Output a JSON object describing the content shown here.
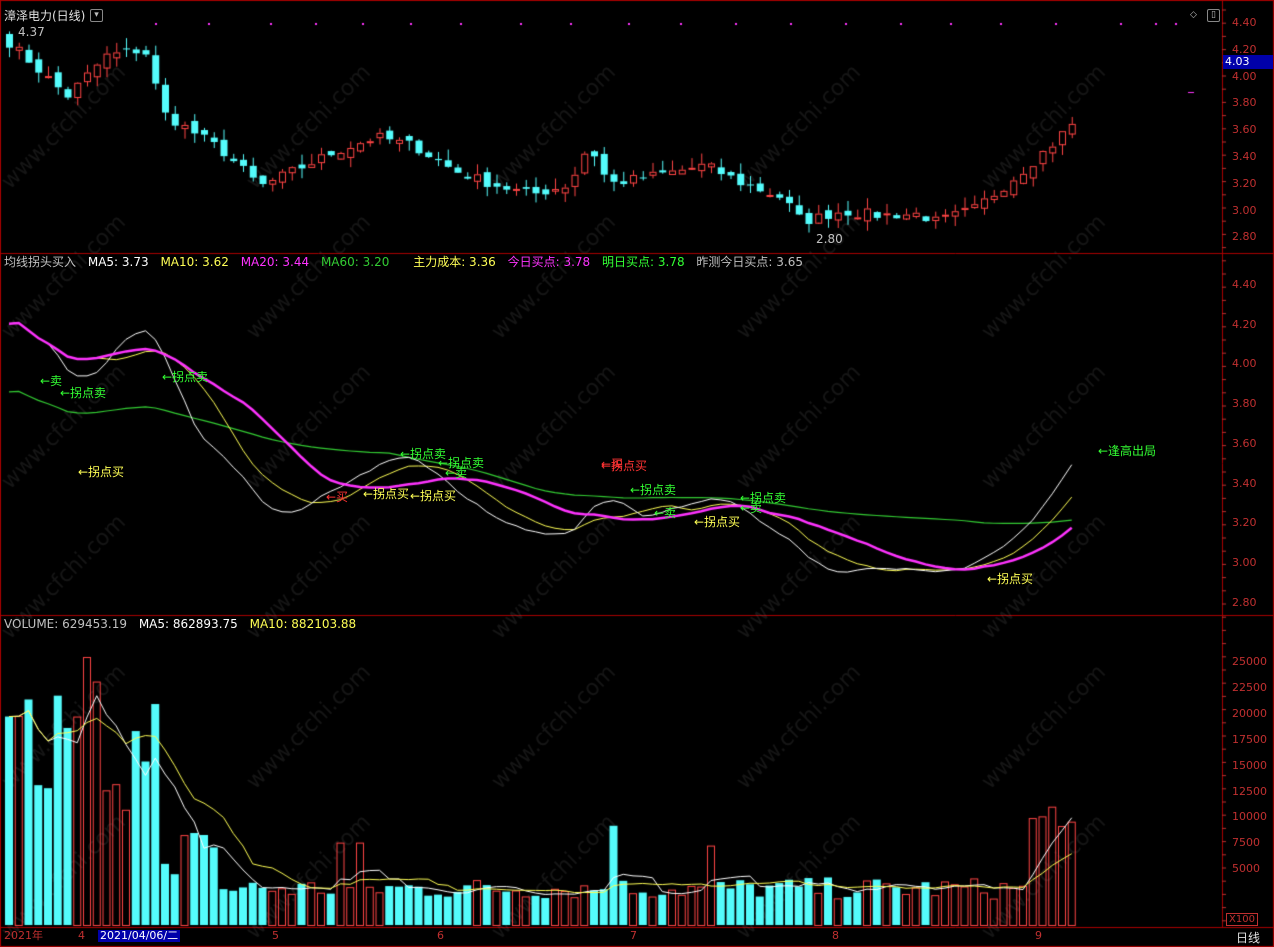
{
  "colors": {
    "up": "#ff4444",
    "down": "#54fcfc",
    "ma5": "#ffffff",
    "ma10": "#ffff55",
    "ma20": "#ff33ff",
    "ma60": "#33cc33",
    "frame": "#aa0000",
    "axis": "#c03030",
    "buy": "#ffff55",
    "sell": "#33ff33",
    "redsig": "#ff3333"
  },
  "header": {
    "title": "漳泽电力(日线)",
    "price_high_label": "4.37",
    "price_low_label": "2.80",
    "current_price": "4.03",
    "price_ticks": [
      "4.40",
      "4.20",
      "4.00",
      "3.80",
      "3.60",
      "3.40",
      "3.20",
      "3.00",
      "2.80"
    ]
  },
  "indicator": {
    "name": "均线拐头买入",
    "ma5": "MA5: 3.73",
    "ma10": "MA10: 3.62",
    "ma20": "MA20: 3.44",
    "ma60": "MA60: 3.20",
    "cost": "主力成本: 3.36",
    "today_buy": "今日买点: 3.78",
    "tomorrow_buy": "明日买点: 3.78",
    "yesterday_guess": "昨测今日买点: 3.65",
    "ticks": [
      "4.40",
      "4.20",
      "4.00",
      "3.80",
      "3.60",
      "3.40",
      "3.20",
      "3.00",
      "2.80"
    ],
    "signals": [
      {
        "text": "←卖",
        "type": "sell"
      },
      {
        "text": "←拐点卖",
        "type": "sell"
      },
      {
        "text": "←拐点卖",
        "type": "sell"
      },
      {
        "text": "←拐点买",
        "type": "buy"
      },
      {
        "text": "←拐点卖",
        "type": "sell"
      },
      {
        "text": "←拐点卖",
        "type": "sell"
      },
      {
        "text": "←卖",
        "type": "sell"
      },
      {
        "text": "←拐点买",
        "type": "buy"
      },
      {
        "text": "←拐点买",
        "type": "buy"
      },
      {
        "text": "←买",
        "type": "redsig"
      },
      {
        "text": "←买",
        "type": "redsig"
      },
      {
        "text": "←拐点买",
        "type": "redsig"
      },
      {
        "text": "←拐点卖",
        "type": "sell"
      },
      {
        "text": "←卖",
        "type": "sell"
      },
      {
        "text": "←拐点买",
        "type": "buy"
      },
      {
        "text": "←拐点卖",
        "type": "sell"
      },
      {
        "text": "←卖",
        "type": "sell"
      },
      {
        "text": "←拐点买",
        "type": "buy"
      },
      {
        "text": "←逢高出局",
        "type": "sell"
      }
    ]
  },
  "volume": {
    "label": "VOLUME: 629453.19",
    "ma5": "MA5: 862893.75",
    "ma10": "MA10: 882103.88",
    "ticks": [
      "25000",
      "22500",
      "20000",
      "17500",
      "15000",
      "12500",
      "10000",
      "7500",
      "5000"
    ],
    "unit": "X100"
  },
  "footer": {
    "dates": [
      "2021年",
      "4",
      "2021/04/06/二",
      "5",
      "6",
      "7",
      "8",
      "9"
    ],
    "period": "日线"
  },
  "watermark": "www.cfchi.com"
}
